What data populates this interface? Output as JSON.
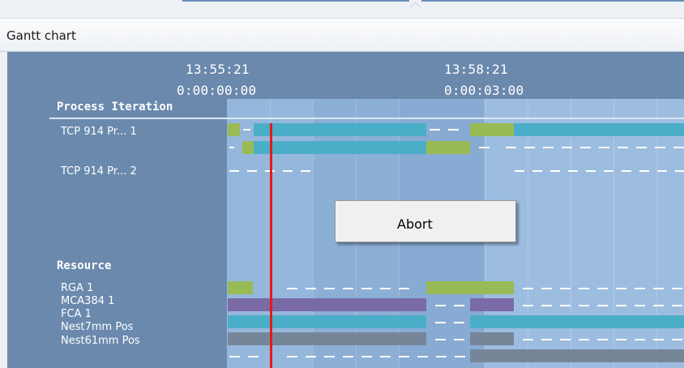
{
  "panel": {
    "title": "Gantt chart"
  },
  "gantt": {
    "time_axis": [
      {
        "clock": "13:55:21",
        "elapsed": "0:00:00:00"
      },
      {
        "clock": "13:58:21",
        "elapsed": "0:00:03:00"
      }
    ],
    "sections": [
      {
        "title": "Process Iteration",
        "rows": [
          {
            "label": "TCP 914 Pr... 1"
          },
          {
            "label": "TCP 914 Pr... 2"
          }
        ]
      },
      {
        "title": "Resource",
        "rows": [
          {
            "label": "RGA 1"
          },
          {
            "label": "MCA384 1"
          },
          {
            "label": "FCA 1"
          },
          {
            "label": "Nest7mm  Pos"
          },
          {
            "label": "Nest61mm  Pos"
          }
        ]
      }
    ],
    "colors": {
      "background": "#6a89ad",
      "plot": "#8caed4",
      "cyan_task": "#4aaec8",
      "green_task": "#99bb55",
      "purple_task": "#7a6aa6",
      "gray_task": "#768699",
      "current_time_marker": "#e81818"
    }
  },
  "context_menu": {
    "items": [
      {
        "label": "Abort"
      }
    ]
  }
}
